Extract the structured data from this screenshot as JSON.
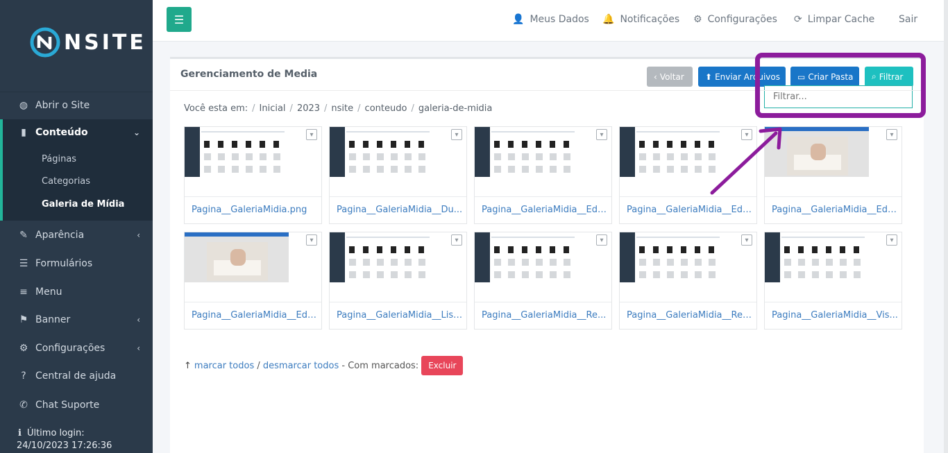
{
  "brand": {
    "logo_text": "NSITE"
  },
  "sidebar": {
    "items": [
      {
        "label": "Abrir o Site",
        "icon": "globe-icon"
      },
      {
        "label": "Conteúdo",
        "icon": "file-icon"
      },
      {
        "label": "Aparência",
        "icon": "brush-icon"
      },
      {
        "label": "Formulários",
        "icon": "database-icon"
      },
      {
        "label": "Menu",
        "icon": "menu-icon"
      },
      {
        "label": "Banner",
        "icon": "flag-icon"
      },
      {
        "label": "Configurações",
        "icon": "gear-icon"
      },
      {
        "label": "Central de ajuda",
        "icon": "question-icon"
      },
      {
        "label": "Chat Suporte",
        "icon": "whatsapp-icon"
      }
    ],
    "sub_items": [
      "Páginas",
      "Categorias",
      "Galeria de Mídia"
    ],
    "last_login_label": "Último login:",
    "last_login_date": "24/10/2023 17:26:36"
  },
  "topbar": {
    "meus_dados": "Meus Dados",
    "notificacoes": "Notificações",
    "configuracoes": "Configurações",
    "limpar_cache": "Limpar Cache",
    "sair": "Sair"
  },
  "panel": {
    "title": "Gerenciamento de Media",
    "btn_voltar": "Voltar",
    "btn_enviar": "Enviar Arquivos",
    "btn_criar": "Criar Pasta",
    "btn_filtrar": "Filtrar",
    "filter_placeholder": "Filtrar..."
  },
  "breadcrumb": {
    "prefix": "Você esta em:",
    "items": [
      "Inicial",
      "2023",
      "nsite",
      "conteudo",
      "galeria-de-midia"
    ]
  },
  "files": [
    "Pagina__GaleriaMidia.png",
    "Pagina__GaleriaMidia__Du...",
    "Pagina__GaleriaMidia__Edit...",
    "Pagina__GaleriaMidia__Edit...",
    "Pagina__GaleriaMidia__Edit...",
    "Pagina__GaleriaMidia__Edit...",
    "Pagina__GaleriaMidia__List....",
    "Pagina__GaleriaMidia__Re...",
    "Pagina__GaleriaMidia__Ren...",
    "Pagina__GaleriaMidia__Vis..."
  ],
  "actions": {
    "marcar": "marcar todos",
    "slash": "/",
    "desmarcar": "desmarcar todos",
    "com_marcados": "- Com marcados:",
    "excluir": "Excluir"
  },
  "colors": {
    "sidebar_bg": "#2b3a4a",
    "accent_green": "#20a98c",
    "primary_blue": "#1976c8",
    "filter_cyan": "#1ec0c0",
    "highlight_purple": "#8c1c9c",
    "danger": "#e8465a"
  }
}
